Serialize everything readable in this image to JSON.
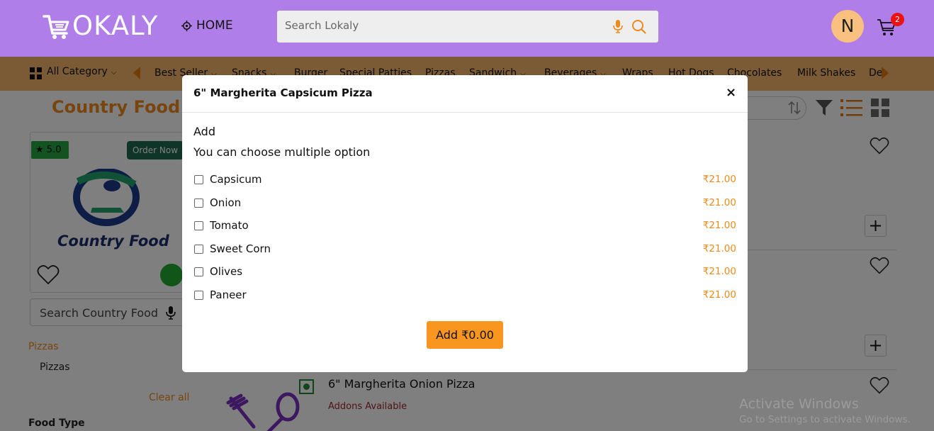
{
  "header": {
    "logo_text": "OKALY",
    "home_label": "HOME",
    "search_placeholder": "Search Lokaly",
    "avatar_initial": "N",
    "cart_count": "2"
  },
  "category_bar": {
    "all_category": "All Category",
    "items": [
      "Best Seller",
      "Snacks",
      "Burger",
      "Special Patties",
      "Pizzas",
      "Sandwich",
      "Beverages",
      "Wraps",
      "Hot Dogs",
      "Chocolates",
      "Milk Shakes",
      "De"
    ]
  },
  "vendor": {
    "title": "Country Food",
    "rating": "5.0",
    "order_now": "Order Now",
    "logo_name": "Country Food",
    "search_placeholder": "Search Country Food"
  },
  "sidebar": {
    "category": "Pizzas",
    "subcategory": "Pizzas",
    "clear_all": "Clear all",
    "food_type": "Food Type"
  },
  "product_list": {
    "visible_item_name": "6\" Margherita Onion Pizza",
    "visible_item_addons": "Addons Available"
  },
  "modal": {
    "title": "6\" Margherita Capsicum Pizza",
    "close": "×",
    "group_label": "Add",
    "hint": "You can choose multiple option",
    "options": [
      {
        "label": "Capsicum",
        "price": "₹21.00",
        "checked": false
      },
      {
        "label": "Onion",
        "price": "₹21.00",
        "checked": false
      },
      {
        "label": "Tomato",
        "price": "₹21.00",
        "checked": false
      },
      {
        "label": "Sweet Corn",
        "price": "₹21.00",
        "checked": false
      },
      {
        "label": "Olives",
        "price": "₹21.00",
        "checked": false
      },
      {
        "label": "Paneer",
        "price": "₹21.00",
        "checked": false
      }
    ],
    "add_button": "Add ₹0.00"
  },
  "watermark": {
    "title": "Activate Windows",
    "subtitle": "Go to Settings to activate Windows."
  },
  "colors": {
    "header_bg": "#b07ee8",
    "catbar_bg": "#f4b66a",
    "accent_orange": "#f08a1c",
    "button_orange": "#f89620"
  }
}
